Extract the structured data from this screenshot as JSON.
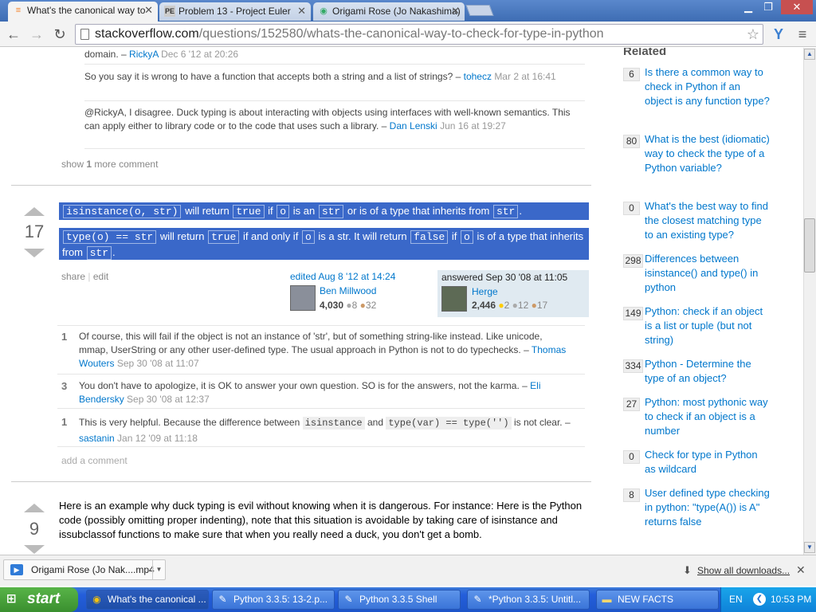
{
  "browser": {
    "tabs": [
      {
        "title": "What's the canonical way to",
        "icon": "stackoverflow-icon"
      },
      {
        "title": "Problem 13 - Project Euler",
        "icon": "project-euler-icon"
      },
      {
        "title": "Origami Rose (Jo Nakashima)",
        "icon": "youtube-icon"
      }
    ],
    "url_host": "stackoverflow.com",
    "url_path": "/questions/152580/whats-the-canonical-way-to-check-for-type-in-python"
  },
  "comments_top": [
    {
      "text": "domain. –",
      "user": "RickyA",
      "date": "Dec 6 '12 at 20:26"
    },
    {
      "text": "So you say it is wrong to have a function that accepts both a string and a list of strings? –",
      "user": "tohecz",
      "date": "Mar 2 at 16:41"
    },
    {
      "text": "@RickyA, I disagree. Duck typing is about interacting with objects using interfaces with well-known semantics. This can apply either to library code or to the code that uses such a library. –",
      "user": "Dan Lenski",
      "date": "Jun 16 at 19:27"
    }
  ],
  "show_more": {
    "prefix": "show",
    "count": "1",
    "suffix": "more comment"
  },
  "answer1": {
    "votes": "17",
    "line1": {
      "code1": "isinstance(o, str)",
      "t1": "will return",
      "code2": "true",
      "t2": "if",
      "code3": "o",
      "t3": "is an",
      "code4": "str",
      "t4": "or is of a type that inherits from",
      "code5": "str",
      "t5": "."
    },
    "line2": {
      "code1": "type(o) == str",
      "t1": "will return",
      "code2": "true",
      "t2": "if and only if",
      "code3": "o",
      "t3": "is a str. It will return",
      "code4": "false",
      "t4": "if",
      "code5": "o",
      "t5": "is of a type that inherits from",
      "code6": "str",
      "t6": "."
    },
    "share": "share",
    "edit": "edit",
    "edited": {
      "label": "edited Aug 8 '12 at 14:24",
      "user": "Ben Millwood",
      "rep": "4,030",
      "silver": "8",
      "bronze": "32"
    },
    "answered": {
      "label": "answered Sep 30 '08 at 11:05",
      "user": "Herge",
      "rep": "2,446",
      "gold": "2",
      "silver": "12",
      "bronze": "17"
    }
  },
  "comments_answer": [
    {
      "score": "1",
      "text": "Of course, this will fail if the object is not an instance of 'str', but of something string-like instead. Like unicode, mmap, UserString or any other user-defined type. The usual approach in Python is not to do typechecks. –",
      "user": "Thomas Wouters",
      "date": "Sep 30 '08 at 11:07"
    },
    {
      "score": "3",
      "text": "You don't have to apologize, it is OK to answer your own question. SO is for the answers, not the karma. –",
      "user": "Eli Bendersky",
      "date": "Sep 30 '08 at 12:37"
    },
    {
      "score": "1",
      "pre": "This is very helpful. Because the difference between",
      "code1": "isinstance",
      "mid": "and",
      "code2": "type(var) == type('')",
      "post": "is not clear. –",
      "user": "sastanin",
      "date": "Jan 12 '09 at 11:18"
    }
  ],
  "add_comment": "add a comment",
  "answer2": {
    "votes": "9",
    "text": "Here is an example why duck typing is evil without knowing when it is dangerous. For instance: Here is the Python code (possibly omitting proper indenting), note that this situation is avoidable by taking care of isinstance and issubclassof functions to make sure that when you really need a duck, you don't get a bomb."
  },
  "related": {
    "heading": "Related",
    "items": [
      {
        "count": "6",
        "title": "Is there a common way to check in Python if an object is any function type?"
      },
      {
        "count": "80",
        "title": "What is the best (idiomatic) way to check the type of a Python variable?"
      },
      {
        "count": "0",
        "title": "What's the best way to find the closest matching type to an existing type?"
      },
      {
        "count": "298",
        "title": "Differences between isinstance() and type() in python"
      },
      {
        "count": "149",
        "title": "Python: check if an object is a list or tuple (but not string)"
      },
      {
        "count": "334",
        "title": "Python - Determine the type of an object?"
      },
      {
        "count": "27",
        "title": "Python: most pythonic way to check if an object is a number"
      },
      {
        "count": "0",
        "title": "Check for type in Python as wildcard"
      },
      {
        "count": "8",
        "title": "User defined type checking in python: \"type(A()) is A\" returns false"
      }
    ]
  },
  "downloads": {
    "file": "Origami Rose (Jo Nak....mp4",
    "show_all": "Show all downloads..."
  },
  "taskbar": {
    "start": "start",
    "tasks": [
      {
        "label": "What's the canonical ...",
        "icon": "chrome-icon"
      },
      {
        "label": "Python 3.3.5: 13-2.p...",
        "icon": "python-icon"
      },
      {
        "label": "Python 3.3.5 Shell",
        "icon": "python-icon"
      },
      {
        "label": "*Python 3.3.5: Untitl...",
        "icon": "python-icon"
      },
      {
        "label": "NEW FACTS",
        "icon": "folder-icon"
      }
    ],
    "lang": "EN",
    "time": "10:53 PM"
  }
}
